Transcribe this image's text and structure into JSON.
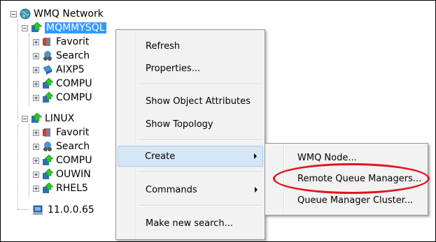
{
  "tree": {
    "root": "WMQ Network",
    "mqmmysql": "MQMMYSQL",
    "m_fav": "Favorit",
    "m_search": "Search",
    "m_aix": "AIXP5",
    "m_comp1": "COMPU",
    "m_comp2": "COMPU",
    "linux": "LINUX",
    "l_fav": "Favorit",
    "l_search": "Search",
    "l_comp": "COMPU",
    "l_ouw": "OUWIN",
    "l_rhel": "RHEL5",
    "ip": "11.0.0.65"
  },
  "context_menu": {
    "refresh": "Refresh",
    "properties": "Properties...",
    "show_object_attributes": "Show Object Attributes",
    "show_topology": "Show Topology",
    "create": "Create",
    "commands": "Commands",
    "make_new_search": "Make new search..."
  },
  "submenu": {
    "wmq_node": "WMQ Node...",
    "remote_queue_managers": "Remote Queue Managers...",
    "queue_manager_cluster": "Queue Manager Cluster..."
  },
  "colors": {
    "selection": "#3399ff",
    "menu_background": "#f2f2f2",
    "menu_highlight": "#d5e6f7",
    "annotation_oval": "#e0141e"
  }
}
